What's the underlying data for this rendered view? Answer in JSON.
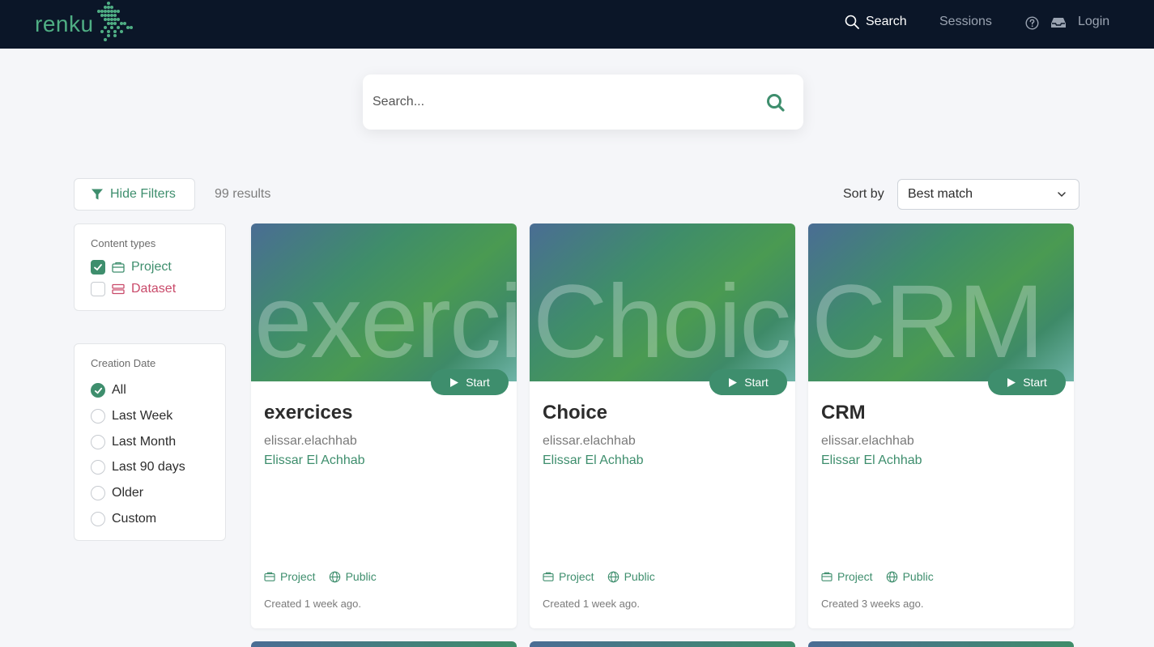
{
  "navbar": {
    "logo_text": "renku",
    "search": "Search",
    "sessions": "Sessions",
    "login": "Login"
  },
  "search": {
    "placeholder": "Search..."
  },
  "toolbar": {
    "filter_button": "Hide Filters",
    "results": "99 results",
    "sort_label": "Sort by",
    "sort_value": "Best match"
  },
  "filters": {
    "content_types": {
      "title": "Content types",
      "items": [
        {
          "label": "Project",
          "checked": true
        },
        {
          "label": "Dataset",
          "checked": false
        }
      ]
    },
    "creation_date": {
      "title": "Creation Date",
      "options": [
        "All",
        "Last Week",
        "Last Month",
        "Last 90 days",
        "Older",
        "Custom"
      ],
      "selected": "All"
    }
  },
  "cards": [
    {
      "banner": "exercices",
      "title": "exercices",
      "user": "elissar.elachhab",
      "owner": "Elissar El Achhab",
      "start": "Start",
      "type": "Project",
      "visibility": "Public",
      "created": "Created 1 week ago."
    },
    {
      "banner": "Choice",
      "title": "Choice",
      "user": "elissar.elachhab",
      "owner": "Elissar El Achhab",
      "start": "Start",
      "type": "Project",
      "visibility": "Public",
      "created": "Created 1 week ago."
    },
    {
      "banner": "CRM",
      "title": "CRM",
      "user": "elissar.elachhab",
      "owner": "Elissar El Achhab",
      "start": "Start",
      "type": "Project",
      "visibility": "Public",
      "created": "Created 3 weeks ago."
    }
  ],
  "colors": {
    "brand_green": "#3e8e6d",
    "navbar_bg": "#0b1628",
    "dataset_red": "#c94a6a"
  }
}
